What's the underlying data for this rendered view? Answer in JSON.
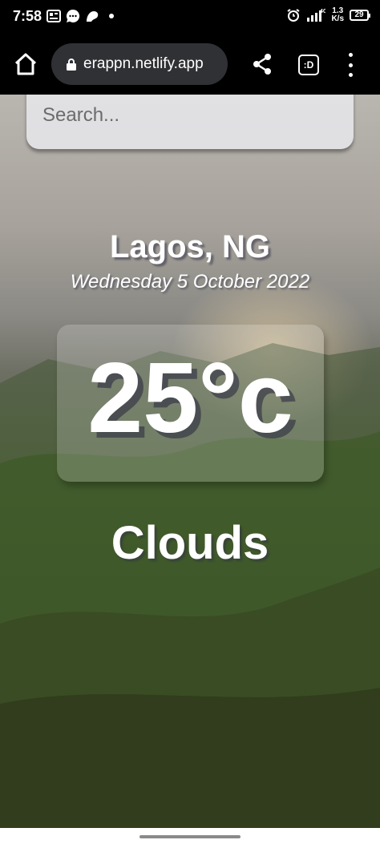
{
  "status_bar": {
    "time": "7:58",
    "net_speed_value": "1.3",
    "net_speed_unit": "K/s",
    "network": "4G",
    "battery": "29"
  },
  "browser": {
    "url": "erappn.netlify.app",
    "tabs_label": ":D"
  },
  "search": {
    "placeholder": "Search..."
  },
  "weather": {
    "location": "Lagos, NG",
    "date": "Wednesday 5 October 2022",
    "temperature": "25°c",
    "condition": "Clouds"
  }
}
